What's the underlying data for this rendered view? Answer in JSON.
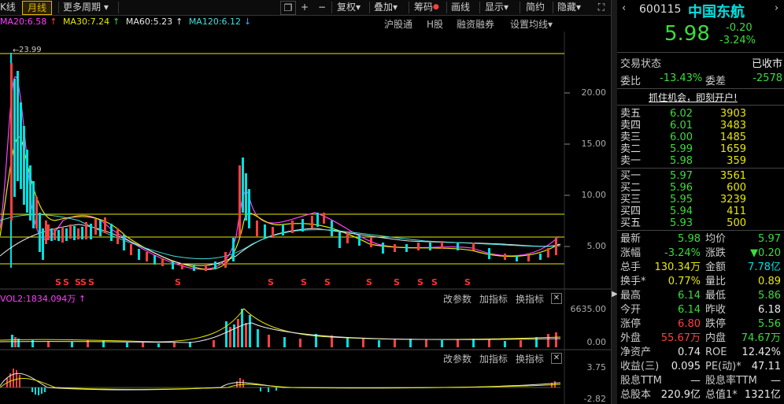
{
  "toolbar": {
    "left_tab": "K线",
    "month_tab": "月线",
    "more_period": "更多周期",
    "fuquan": "复权",
    "diejia": "叠加",
    "chouma": "筹码",
    "huaxian": "画线",
    "xianshi": "显示",
    "jianyue": "简约",
    "yincang": "隐藏"
  },
  "ma": {
    "ma20": "MA20:6.58",
    "ma30": "MA30:7.24",
    "ma60": "MA60:5.23",
    "ma120": "MA120:6.12"
  },
  "chart_links": [
    "沪股通",
    "H股",
    "融资融券",
    "设置均线"
  ],
  "price_axis": [
    "20.00",
    "15.00",
    "10.00",
    "5.00"
  ],
  "peak_label": "23.99",
  "volume": {
    "label": "VOL2:1834.094万",
    "buttons": [
      "改参数",
      "加指标",
      "换指标"
    ],
    "axis": [
      "6635.00",
      "0.00"
    ]
  },
  "macd": {
    "buttons": [
      "改参数",
      "加指标",
      "换指标"
    ],
    "axis": [
      "3.75",
      "-2.82"
    ]
  },
  "stock": {
    "code": "600115",
    "name": "中国东航",
    "price": "5.98",
    "change": "-0.20",
    "change_pct": "-3.24%",
    "status_label": "交易状态",
    "status_value": "已收市",
    "weibi_label": "委比",
    "weibi_value": "-13.43%",
    "weicha_label": "委差",
    "weicha_value": "-2578",
    "promo": "抓住机会，即刻开户!"
  },
  "order_book": {
    "sell": [
      {
        "label": "卖五",
        "price": "6.02",
        "vol": "3903"
      },
      {
        "label": "卖四",
        "price": "6.01",
        "vol": "3483"
      },
      {
        "label": "卖三",
        "price": "6.00",
        "vol": "1485"
      },
      {
        "label": "卖二",
        "price": "5.99",
        "vol": "1659"
      },
      {
        "label": "卖一",
        "price": "5.98",
        "vol": "359"
      }
    ],
    "buy": [
      {
        "label": "买一",
        "price": "5.97",
        "vol": "3561"
      },
      {
        "label": "买二",
        "price": "5.96",
        "vol": "600"
      },
      {
        "label": "买三",
        "price": "5.95",
        "vol": "3239"
      },
      {
        "label": "买四",
        "price": "5.94",
        "vol": "411"
      },
      {
        "label": "买五",
        "price": "5.93",
        "vol": "500"
      }
    ]
  },
  "stats": [
    {
      "l1": "最新",
      "v1": "5.98",
      "c1": "green",
      "l2": "均价",
      "v2": "5.97",
      "c2": "green"
    },
    {
      "l1": "涨幅",
      "v1": "-3.24%",
      "c1": "green",
      "l2": "涨跌",
      "v2": "▼0.20",
      "c2": "green"
    },
    {
      "l1": "总手",
      "v1": "130.34万",
      "c1": "yellow",
      "l2": "金额",
      "v2": "7.78亿",
      "c2": "cyan"
    },
    {
      "l1": "换手*",
      "v1": "0.77%",
      "c1": "yellow",
      "l2": "量比",
      "v2": "0.89",
      "c2": "yellow"
    },
    {
      "l1": "最高",
      "v1": "6.14",
      "c1": "green",
      "l2": "最低",
      "v2": "5.86",
      "c2": "green"
    },
    {
      "l1": "今开",
      "v1": "6.14",
      "c1": "green",
      "l2": "昨收",
      "v2": "6.18",
      "c2": "white"
    },
    {
      "l1": "涨停",
      "v1": "6.80",
      "c1": "red",
      "l2": "跌停",
      "v2": "5.56",
      "c2": "green"
    },
    {
      "l1": "外盘",
      "v1": "55.67万",
      "c1": "red",
      "l2": "内盘",
      "v2": "74.67万",
      "c2": "green"
    },
    {
      "l1": "净资产",
      "v1": "0.74",
      "c1": "white",
      "l2": "ROE",
      "v2": "12.42%",
      "c2": "white"
    },
    {
      "l1": "收益(三)",
      "v1": "0.095",
      "c1": "white",
      "l2": "PE(动)*",
      "v2": "47.11",
      "c2": "white"
    },
    {
      "l1": "股息TTM",
      "v1": "—",
      "c1": "white",
      "l2": "股息率TTM",
      "v2": "—",
      "c2": "white"
    },
    {
      "l1": "总股本",
      "v1": "220.9亿",
      "c1": "white",
      "l2": "总值1*",
      "v2": "1321亿",
      "c2": "white"
    }
  ],
  "colors": {
    "up": "#ff4040",
    "down": "#00e0e0",
    "accent": "#e8b400"
  }
}
